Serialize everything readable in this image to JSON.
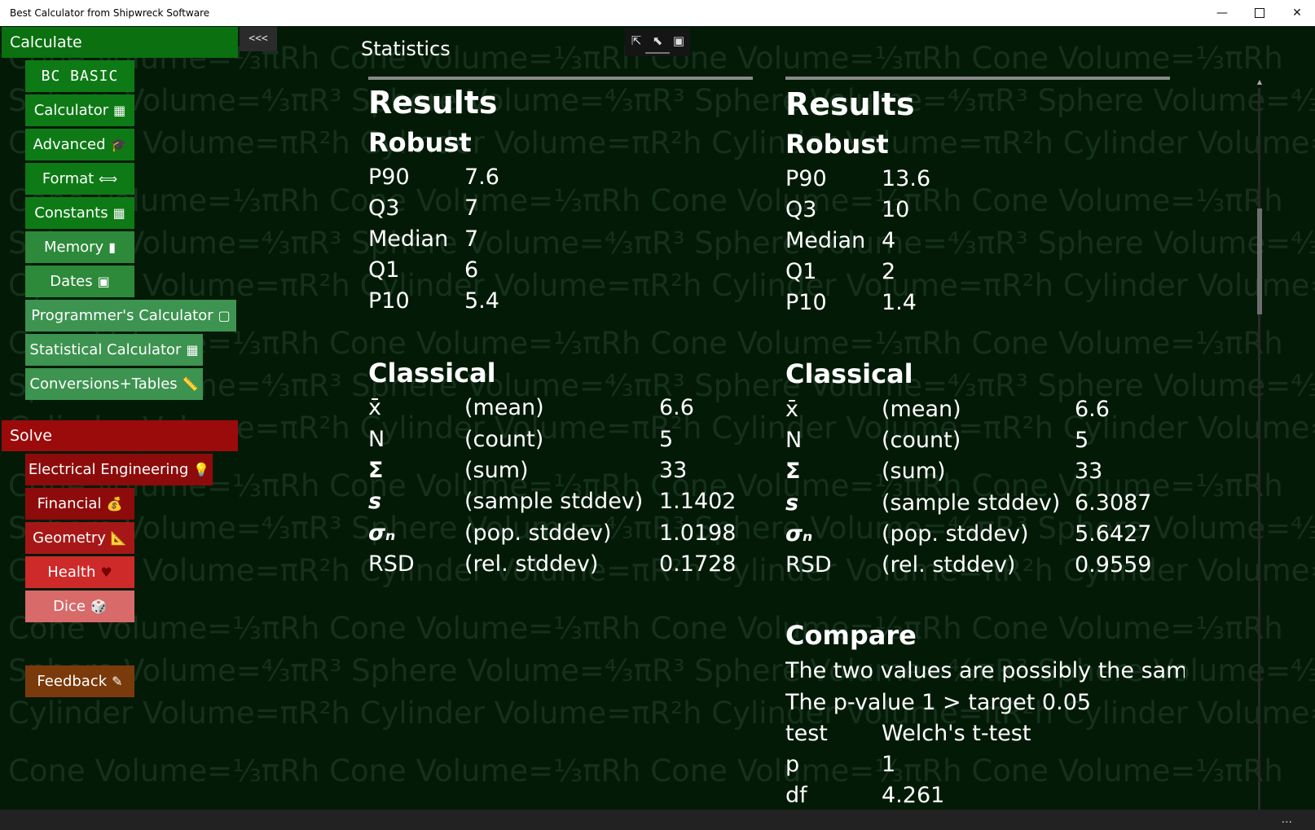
{
  "window": {
    "title": "Best Calculator from Shipwreck Software",
    "minimize": "—",
    "close": "✕"
  },
  "background_lines": [
    "Cone Volume=⅓πRh    Cone Volume=⅓πRh    Cone Volume=⅓πRh    Cone Volume=⅓πRh",
    "Sphere Volume=⁴⁄₃πR³   Sphere Volume=⁴⁄₃πR³   Sphere Volume=⁴⁄₃πR³   Sphere Volume=⁴⁄₃πR³",
    "Cylinder Volume=πR²h   Cylinder Volume=πR²h   Cylinder Volume=πR²h   Cylinder Volume=πR²h"
  ],
  "sidebar": {
    "calculate_header": "Calculate",
    "collapse_label": "<<<",
    "calculate_items": [
      {
        "label": "BC BASIC",
        "icon": ""
      },
      {
        "label": "Calculator",
        "icon": "▦"
      },
      {
        "label": "Advanced",
        "icon": "🎓"
      },
      {
        "label": "Format",
        "icon": "⟺"
      },
      {
        "label": "Constants",
        "icon": "▦"
      },
      {
        "label": "Memory",
        "icon": "▮"
      },
      {
        "label": "Dates",
        "icon": "▣"
      },
      {
        "label": "Programmer's Calculator",
        "icon": "▢"
      },
      {
        "label": "Statistical Calculator",
        "icon": "▦"
      },
      {
        "label": "Conversions+Tables",
        "icon": "📏"
      }
    ],
    "solve_header": "Solve",
    "solve_items": [
      {
        "label": "Electrical Engineering",
        "icon": "💡"
      },
      {
        "label": "Financial",
        "icon": "💰"
      },
      {
        "label": "Geometry",
        "icon": "📐"
      },
      {
        "label": "Health",
        "icon": "♥"
      },
      {
        "label": "Dice",
        "icon": "🎲"
      }
    ],
    "feedback": {
      "label": "Feedback",
      "icon": "✎"
    }
  },
  "main": {
    "page_title": "Statistics",
    "left": {
      "results_title": "Results",
      "robust_title": "Robust",
      "robust": [
        {
          "label": "P90",
          "value": "7.6"
        },
        {
          "label": "Q3",
          "value": "7"
        },
        {
          "label": "Median",
          "value": "7"
        },
        {
          "label": "Q1",
          "value": "6"
        },
        {
          "label": "P10",
          "value": "5.4"
        }
      ],
      "classical_title": "Classical",
      "classical": [
        {
          "sym": "x̄",
          "desc": "(mean)",
          "value": "6.6"
        },
        {
          "sym": "N",
          "desc": "(count)",
          "value": "5"
        },
        {
          "sym": "Σ",
          "desc": "(sum)",
          "value": "33"
        },
        {
          "sym": "s",
          "desc": "(sample stddev)",
          "value": "1.1402"
        },
        {
          "sym": "σₙ",
          "desc": "(pop. stddev)",
          "value": "1.0198"
        },
        {
          "sym": "RSD",
          "desc": "(rel. stddev)",
          "value": "0.1728"
        }
      ]
    },
    "right": {
      "results_title": "Results",
      "robust_title": "Robust",
      "robust": [
        {
          "label": "P90",
          "value": "13.6"
        },
        {
          "label": "Q3",
          "value": "10"
        },
        {
          "label": "Median",
          "value": "4"
        },
        {
          "label": "Q1",
          "value": "2"
        },
        {
          "label": "P10",
          "value": "1.4"
        }
      ],
      "classical_title": "Classical",
      "classical": [
        {
          "sym": "x̄",
          "desc": "(mean)",
          "value": "6.6"
        },
        {
          "sym": "N",
          "desc": "(count)",
          "value": "5"
        },
        {
          "sym": "Σ",
          "desc": "(sum)",
          "value": "33"
        },
        {
          "sym": "s",
          "desc": "(sample stddev)",
          "value": "6.3087"
        },
        {
          "sym": "σₙ",
          "desc": "(pop. stddev)",
          "value": "5.6427"
        },
        {
          "sym": "RSD",
          "desc": "(rel. stddev)",
          "value": "0.9559"
        }
      ],
      "compare_title": "Compare",
      "compare_line1": "The two values are possibly the same.",
      "compare_line2": "The p-value 1 > target 0.05",
      "compare_rows": [
        {
          "label": "test",
          "value": "Welch's t-test"
        },
        {
          "label": "p",
          "value": "1"
        },
        {
          "label": "df",
          "value": "4.261"
        }
      ]
    }
  },
  "footer": {
    "more": "..."
  }
}
